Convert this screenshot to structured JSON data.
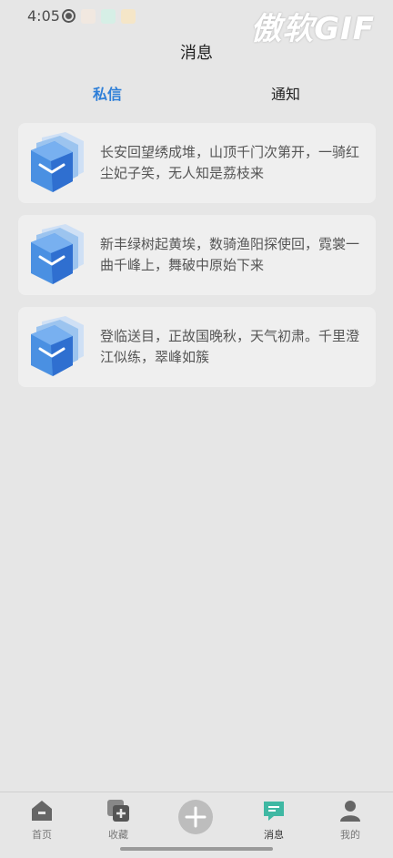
{
  "status_bar": {
    "time": "4:05",
    "icons": [
      "record-icon",
      "app-icon-1",
      "app-icon-2",
      "weibo-icon"
    ]
  },
  "watermark": "傲软GIF",
  "header": {
    "title": "消息"
  },
  "tabs": [
    {
      "label": "私信",
      "active": true
    },
    {
      "label": "通知",
      "active": false
    }
  ],
  "messages": [
    {
      "text": "长安回望绣成堆，山顶千门次第开，一骑红尘妃子笑，无人知是荔枝来",
      "icon": "cube-avatar-icon"
    },
    {
      "text": "新丰绿树起黄埃，数骑渔阳探使回，霓裳一曲千峰上，舞破中原始下来",
      "icon": "cube-avatar-icon"
    },
    {
      "text": "登临送目，正故国晚秋，天气初肃。千里澄江似练，翠峰如簇",
      "icon": "cube-avatar-icon"
    }
  ],
  "bottom_nav": [
    {
      "label": "首页",
      "icon": "home-icon"
    },
    {
      "label": "收藏",
      "icon": "favorite-add-icon"
    },
    {
      "label": "",
      "icon": "plus-icon"
    },
    {
      "label": "消息",
      "icon": "chat-icon",
      "active": true
    },
    {
      "label": "我的",
      "icon": "user-icon"
    }
  ],
  "colors": {
    "accent": "#2f7fd8",
    "background": "#e6e6e6",
    "card": "#efefef",
    "active_nav_icon": "#3fb8a3"
  }
}
